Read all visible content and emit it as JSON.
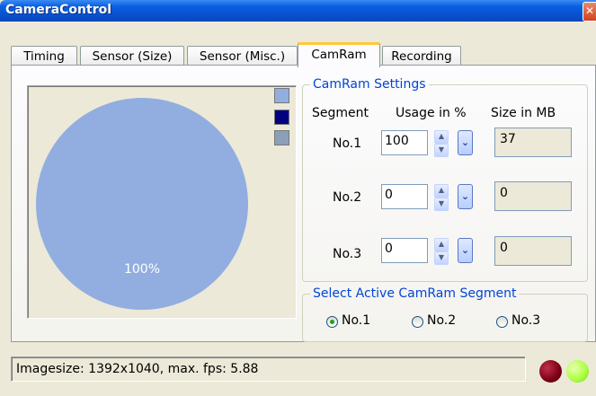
{
  "window": {
    "title": "CameraControl",
    "close_glyph": "✕"
  },
  "tabs": [
    {
      "label": "Timing"
    },
    {
      "label": "Sensor (Size)"
    },
    {
      "label": "Sensor (Misc.)"
    },
    {
      "label": "CamRam",
      "active": true
    },
    {
      "label": "Recording"
    }
  ],
  "pie": {
    "label": "100%",
    "slices": [
      {
        "segment": "No.1",
        "percent": 100,
        "color": "#92aee0"
      }
    ],
    "legend_colors": [
      "#92aee0",
      "#000080",
      "#8aa0b8"
    ]
  },
  "camram_settings": {
    "legend": "CamRam Settings",
    "headers": {
      "segment": "Segment",
      "usage": "Usage in %",
      "size": "Size in MB"
    },
    "rows": [
      {
        "label": "No.1",
        "usage": "100",
        "size": "37"
      },
      {
        "label": "No.2",
        "usage": "0",
        "size": "0"
      },
      {
        "label": "No.3",
        "usage": "0",
        "size": "0"
      }
    ]
  },
  "active_segment": {
    "legend": "Select Active CamRam Segment",
    "options": [
      {
        "label": "No.1",
        "checked": true
      },
      {
        "label": "No.2",
        "checked": false
      },
      {
        "label": "No.3",
        "checked": false
      }
    ]
  },
  "status": {
    "text": "Imagesize: 1392x1040, max. fps: 5.88",
    "led_colors": [
      "#7a0015",
      "#a8ff3a"
    ]
  },
  "colors": {
    "accent": "#0046d5",
    "titlebar": "#0a5fe0"
  }
}
